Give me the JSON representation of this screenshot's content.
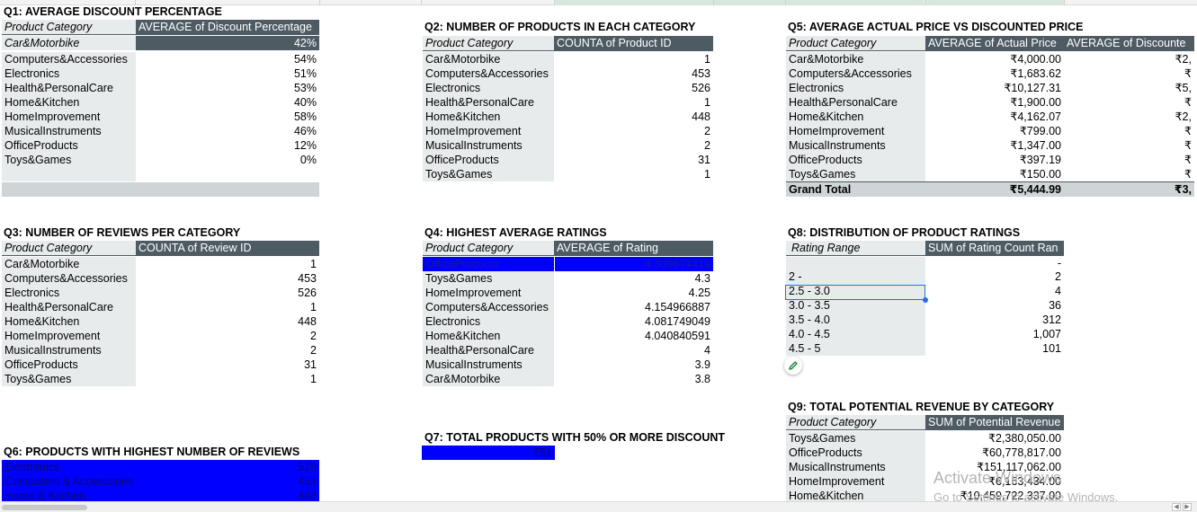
{
  "q1": {
    "title": "Q1: AVERAGE DISCOUNT PERCENTAGE",
    "header": [
      "Product Category",
      "AVERAGE of Discount Percentage"
    ],
    "first_row": [
      "Car&Motorbike",
      "42%"
    ],
    "rows": [
      [
        "Computers&Accessories",
        "54%"
      ],
      [
        "Electronics",
        "51%"
      ],
      [
        "Health&PersonalCare",
        "53%"
      ],
      [
        "Home&Kitchen",
        "40%"
      ],
      [
        "HomeImprovement",
        "58%"
      ],
      [
        "MusicalInstruments",
        "46%"
      ],
      [
        "OfficeProducts",
        "12%"
      ],
      [
        "Toys&Games",
        "0%"
      ]
    ]
  },
  "q2": {
    "title": "Q2: NUMBER OF PRODUCTS IN EACH CATEGORY",
    "header": [
      "Product Category",
      "COUNTA of Product ID"
    ],
    "rows": [
      [
        "Car&Motorbike",
        "1"
      ],
      [
        "Computers&Accessories",
        "453"
      ],
      [
        "Electronics",
        "526"
      ],
      [
        "Health&PersonalCare",
        "1"
      ],
      [
        "Home&Kitchen",
        "448"
      ],
      [
        "HomeImprovement",
        "2"
      ],
      [
        "MusicalInstruments",
        "2"
      ],
      [
        "OfficeProducts",
        "31"
      ],
      [
        "Toys&Games",
        "1"
      ]
    ]
  },
  "q5": {
    "title": "Q5: AVERAGE ACTUAL PRICE VS DISCOUNTED PRICE",
    "header": [
      "Product Category",
      "AVERAGE of Actual Price",
      "AVERAGE of Discounte"
    ],
    "rows": [
      [
        "Car&Motorbike",
        "₹4,000.00",
        "₹2,"
      ],
      [
        "Computers&Accessories",
        "₹1,683.62",
        "₹"
      ],
      [
        "Electronics",
        "₹10,127.31",
        "₹5,"
      ],
      [
        "Health&PersonalCare",
        "₹1,900.00",
        "₹"
      ],
      [
        "Home&Kitchen",
        "₹4,162.07",
        "₹2,"
      ],
      [
        "HomeImprovement",
        "₹799.00",
        "₹"
      ],
      [
        "MusicalInstruments",
        "₹1,347.00",
        "₹"
      ],
      [
        "OfficeProducts",
        "₹397.19",
        "₹"
      ],
      [
        "Toys&Games",
        "₹150.00",
        "₹"
      ]
    ],
    "total": [
      "Grand Total",
      "₹5,444.99",
      "₹3,"
    ]
  },
  "q3": {
    "title": "Q3: NUMBER OF REVIEWS PER CATEGORY",
    "header": [
      "Product Category",
      "COUNTA of Review ID"
    ],
    "rows": [
      [
        "Car&Motorbike",
        "1"
      ],
      [
        "Computers&Accessories",
        "453"
      ],
      [
        "Electronics",
        "526"
      ],
      [
        "Health&PersonalCare",
        "1"
      ],
      [
        "Home&Kitchen",
        "448"
      ],
      [
        "HomeImprovement",
        "2"
      ],
      [
        "MusicalInstruments",
        "2"
      ],
      [
        "OfficeProducts",
        "31"
      ],
      [
        "Toys&Games",
        "1"
      ]
    ]
  },
  "q4": {
    "title": "Q4: HIGHEST AVERAGE RATINGS",
    "header": [
      "Product Category",
      "AVERAGE of Rating"
    ],
    "highlight_row": [
      "OfficeProducts",
      "4.309677419"
    ],
    "rows": [
      [
        "Toys&Games",
        "4.3"
      ],
      [
        "HomeImprovement",
        "4.25"
      ],
      [
        "Computers&Accessories",
        "4.154966887"
      ],
      [
        "Electronics",
        "4.081749049"
      ],
      [
        "Home&Kitchen",
        "4.040840591"
      ],
      [
        "Health&PersonalCare",
        "4"
      ],
      [
        "MusicalInstruments",
        "3.9"
      ],
      [
        "Car&Motorbike",
        "3.8"
      ]
    ]
  },
  "q8": {
    "title": "Q8: DISTRIBUTION OF PRODUCT RATINGS",
    "header": [
      "Rating Range",
      "SUM of  Rating Count Ran"
    ],
    "rows": [
      [
        "",
        "-"
      ],
      [
        "2 -",
        "2"
      ],
      [
        "2.5 - 3.0",
        "4"
      ],
      [
        "3.0 - 3.5",
        "36"
      ],
      [
        "3.5 - 4.0",
        "312"
      ],
      [
        "4.0 - 4.5",
        "1,007"
      ],
      [
        "4.5 - 5",
        "101"
      ]
    ]
  },
  "q9": {
    "title": "Q9: TOTAL POTENTIAL REVENUE BY CATEGORY",
    "header": [
      "Product Category",
      "SUM of Potential Revenue"
    ],
    "rows": [
      [
        "Toys&Games",
        "₹2,380,050.00"
      ],
      [
        "OfficeProducts",
        "₹60,778,817.00"
      ],
      [
        "MusicalInstruments",
        "₹151,117,062.00"
      ],
      [
        "HomeImprovement",
        "₹6,163,434.00"
      ],
      [
        "Home&Kitchen",
        "₹10,459,722,337.00"
      ]
    ]
  },
  "q6": {
    "title": "Q6: PRODUCTS WITH HIGHEST NUMBER OF REVIEWS",
    "rows": [
      [
        "Electronics",
        "526"
      ],
      [
        "Computers & Accessories",
        "453"
      ],
      [
        "Home & Kitchen",
        "448"
      ]
    ]
  },
  "q7": {
    "title": "Q7: TOTAL PRODUCTS WITH 50% OR MORE DISCOUNT",
    "value": "751"
  },
  "watermark": {
    "line1": "Activate Windows",
    "line2": "Go to Settings to activate Windows."
  },
  "colors": {
    "header_dark": "#4e5b62",
    "label_bg": "#e8ebec",
    "highlight_blue": "#0000ff",
    "selection": "#1a73e8"
  }
}
